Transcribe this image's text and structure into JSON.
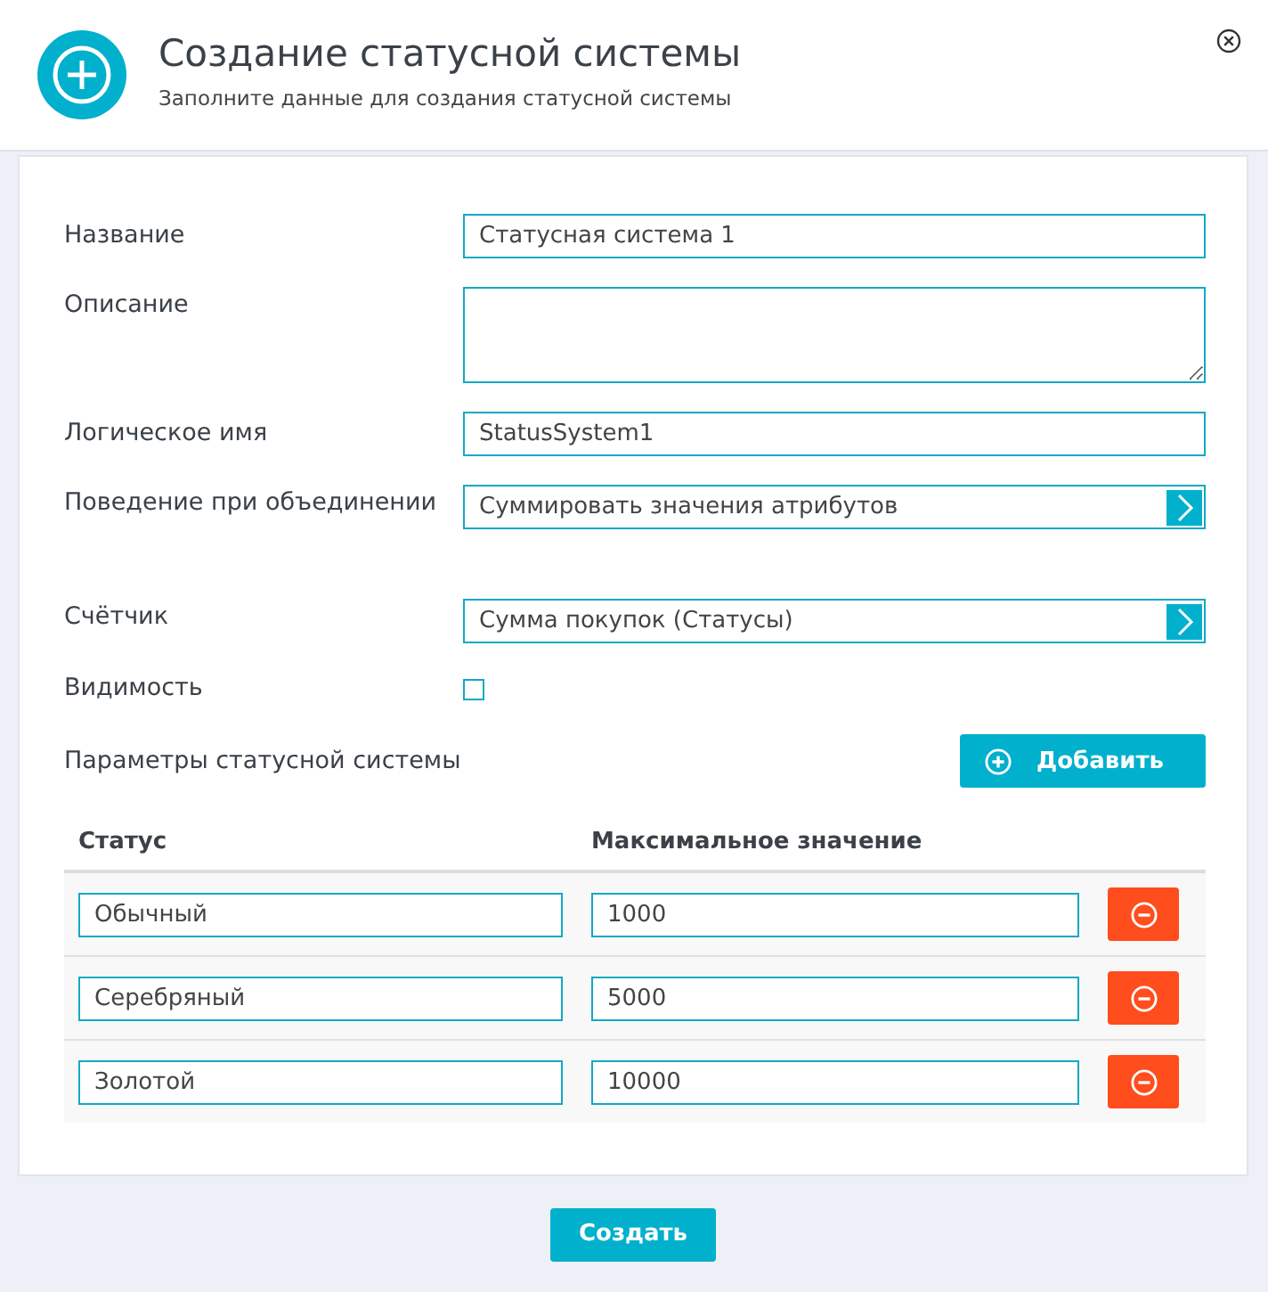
{
  "dialog": {
    "title": "Создание статусной системы",
    "subtitle": "Заполните данные для создания статусной системы"
  },
  "fields": [
    {
      "kind": "text",
      "label": "Название",
      "value": "Статусная система 1"
    },
    {
      "kind": "textarea",
      "label": "Описание"
    },
    {
      "kind": "text",
      "label": "Логическое имя",
      "value": "StatusSystem1"
    },
    {
      "kind": "select",
      "label": "Поведение при объединении",
      "value": "Суммировать значения атрибутов"
    },
    {
      "kind": "select",
      "label": "Счётчик",
      "value": "Сумма покупок (Статусы)"
    },
    {
      "kind": "checkbox",
      "label": "Видимость",
      "checked": false
    }
  ],
  "parameters": {
    "title": "Параметры статусной системы",
    "add_button": "Добавить",
    "table": {
      "columns": [
        "Статус",
        "Максимальное значение"
      ],
      "rows": [
        {
          "status": "Обычный",
          "max_value": "1000"
        },
        {
          "status": "Серебряный",
          "max_value": "5000"
        },
        {
          "status": "Золотой",
          "max_value": "10000"
        }
      ]
    }
  },
  "footer": {
    "create_button": "Создать"
  }
}
